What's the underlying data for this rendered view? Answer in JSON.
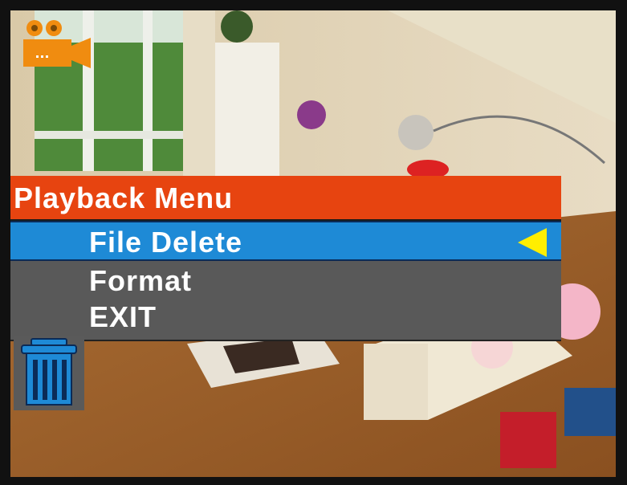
{
  "menu": {
    "title": "Playback Menu",
    "items": [
      {
        "label": "File Delete",
        "selected": true
      },
      {
        "label": "Format",
        "selected": false
      },
      {
        "label": "EXIT",
        "selected": false
      }
    ]
  },
  "icons": {
    "mode": "video-camera-icon",
    "action": "trash-can-icon",
    "selector": "selection-arrow-icon"
  },
  "colors": {
    "title_bar": "#e74410",
    "selected_item": "#1e8ad6",
    "menu_body": "#595959",
    "camera_icon": "#f08c10",
    "arrow": "#ffee00",
    "trash_icon": "#1e8ad6"
  }
}
